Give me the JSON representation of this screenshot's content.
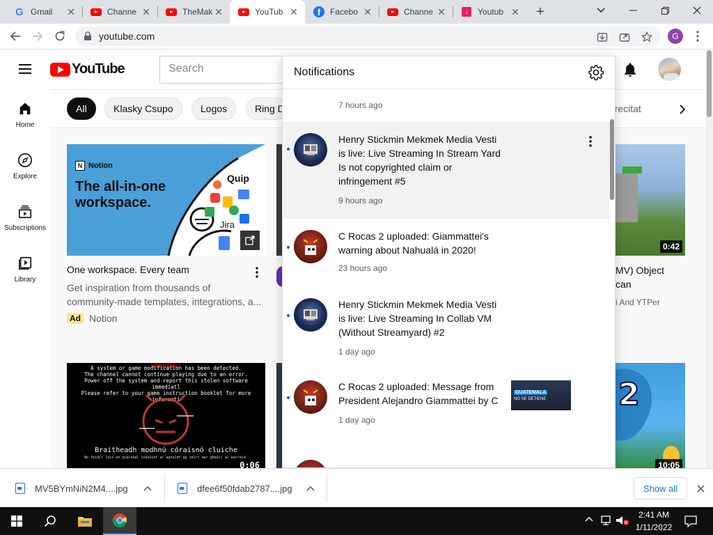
{
  "browser": {
    "tabs": [
      {
        "title": "Gmail",
        "icon": "gmail-icon"
      },
      {
        "title": "Channe",
        "icon": "youtube-icon"
      },
      {
        "title": "TheMak",
        "icon": "youtube-icon"
      },
      {
        "title": "YouTub",
        "icon": "youtube-icon",
        "active": true
      },
      {
        "title": "Facebo",
        "icon": "facebook-icon"
      },
      {
        "title": "Channe",
        "icon": "youtube-icon"
      },
      {
        "title": "Youtub",
        "icon": "download-icon"
      }
    ],
    "url": "youtube.com",
    "profile_initial": "G"
  },
  "youtube": {
    "logo_text": "YouTube",
    "search_placeholder": "Search",
    "sidebar": [
      {
        "label": "Home",
        "icon": "home-icon"
      },
      {
        "label": "Explore",
        "icon": "compass-icon"
      },
      {
        "label": "Subscriptions",
        "icon": "subscriptions-icon"
      },
      {
        "label": "Library",
        "icon": "library-icon"
      }
    ],
    "chips": [
      "All",
      "Klasky Csupo",
      "Logos",
      "Ring D",
      "us recitat"
    ],
    "ad": {
      "thumb_brand": "Notion",
      "thumb_headline_1": "The all-in-one",
      "thumb_headline_2": "workspace.",
      "thumb_tags": [
        "Quip",
        "Jira"
      ],
      "title": "One workspace. Every team",
      "desc_1": "Get inspiration from thousands of",
      "desc_2": "community-made templates, integrations, a...",
      "badge": "Ad",
      "channel": "Notion"
    },
    "right_card": {
      "duration": "0:42",
      "title_1": "MV) Object",
      "title_2": "can",
      "channel": "i And YTPer"
    },
    "bottom_left": {
      "duration": "0:06",
      "warning_title": "WARNING!",
      "line_1": "A system or game modification has been detected.",
      "line_2": "The channel cannot continue playing due to an error.",
      "line_3": "Power off the system and report this stolen software immediatl",
      "line_4": "Please refer to your game instruction booklet for more informati",
      "irish_1": "Braitheadh modhnú córaisnó cluiche",
      "irish_2": "No feidir leis an gcainéal leanúint ar aghaidh ag imirt mar gheall ar earráid."
    },
    "bottom_right": {
      "duration": "10:05"
    }
  },
  "notifications": {
    "title": "Notifications",
    "items": [
      {
        "text": "",
        "time": "7 hours ago"
      },
      {
        "text": "Henry Stickmin Mekmek Media Vesti is live: Live Streaming In Stream Yard Is not copyrighted claim or infringement #5",
        "lines": [
          "Henry Stickmin Mekmek Media Vesti",
          "is live: Live Streaming In Stream Yard",
          "Is not copyrighted claim or",
          "infringement #5"
        ],
        "time": "9 hours ago",
        "highlighted": true
      },
      {
        "lines": [
          "C Rocas 2 uploaded: Giammattei's",
          "warning about Nahualá in 2020!"
        ],
        "time": "23 hours ago"
      },
      {
        "lines": [
          "Henry Stickmin Mekmek Media Vesti",
          "is live: Live Streaming In Collab VM",
          "(Without Streamyard) #2"
        ],
        "time": "1 day ago"
      },
      {
        "lines": [
          "C Rocas 2 uploaded: Message from",
          "President Alejandro Giammattei by C"
        ],
        "time": "1 day ago",
        "thumb_caption_1": "GUATEMALA",
        "thumb_caption_2": "NO SE DETIENE"
      }
    ]
  },
  "downloads": {
    "items": [
      "MV5BYmNiN2M4....jpg",
      "dfee6f50fdab2787....jpg"
    ],
    "show_all": "Show all"
  },
  "taskbar": {
    "time": "2:41 AM",
    "date": "1/11/2022"
  },
  "colors": {
    "youtube_red": "#ff0000",
    "unread_dot": "#065fd4",
    "chrome_link_blue": "#1a73e8",
    "ad_badge_yellow": "#fce78d"
  }
}
